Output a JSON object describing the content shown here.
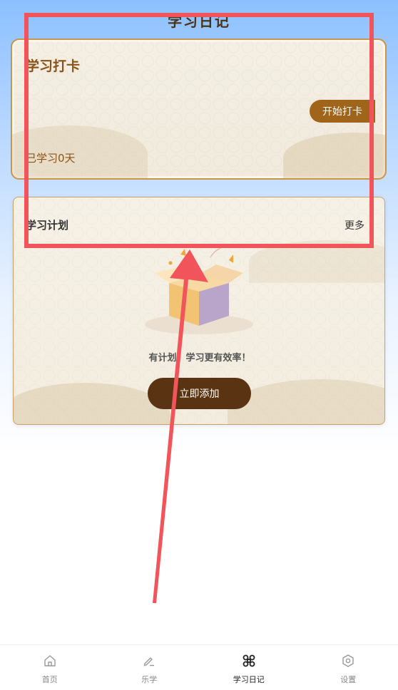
{
  "header": {
    "title": "学习日记"
  },
  "checkin": {
    "title": "学习打卡",
    "button_label": "开始打卡",
    "days_label": "已学习0天"
  },
  "plan": {
    "title": "学习计划",
    "more_label": "更多",
    "slogan": "有计划，学习更有效率！",
    "add_button_label": "立即添加"
  },
  "nav": {
    "items": [
      {
        "label": "首页",
        "icon": "home-icon"
      },
      {
        "label": "乐学",
        "icon": "pen-icon"
      },
      {
        "label": "学习日记",
        "icon": "command-icon",
        "active": true
      },
      {
        "label": "设置",
        "icon": "gear-icon"
      }
    ]
  },
  "colors": {
    "accent_brown": "#a0641a",
    "dark_brown": "#5a3412",
    "annotation_red": "#f2545b"
  }
}
